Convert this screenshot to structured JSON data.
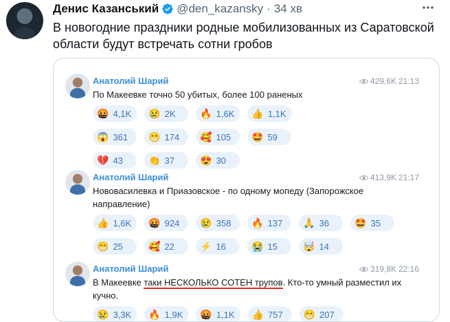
{
  "tweet": {
    "author": "Денис Казанський",
    "handle": "@den_kazansky",
    "dot": "·",
    "time": "34 хв",
    "text": "В новогодние праздники родные мобилизованных из Саратовской области будут встречать сотни гробов"
  },
  "quote": {
    "posts": [
      {
        "author": "Анатолий Шарий",
        "views": "429,6K",
        "time": "21:13",
        "text": "По Макеевке точно 50 убитых, более 100 раненых",
        "reaction_rows": [
          [
            {
              "emoji": "🤬",
              "count": "4,1K"
            },
            {
              "emoji": "😢",
              "count": "2K"
            },
            {
              "emoji": "🔥",
              "count": "1,6K"
            },
            {
              "emoji": "👍",
              "count": "1,1K"
            }
          ],
          [
            {
              "emoji": "😱",
              "count": "361"
            },
            {
              "emoji": "😁",
              "count": "174"
            },
            {
              "emoji": "🥰",
              "count": "105"
            },
            {
              "emoji": "🤩",
              "count": "59"
            }
          ],
          [
            {
              "emoji": "💔",
              "count": "43"
            },
            {
              "emoji": "👏",
              "count": "37"
            },
            {
              "emoji": "😍",
              "count": "30"
            }
          ]
        ]
      },
      {
        "author": "Анатолий Шарий",
        "views": "413,9K",
        "time": "21:17",
        "text": "Нововасилевка и Приазовское - по одному мопеду (Запорожское направление)",
        "reaction_rows": [
          [
            {
              "emoji": "👍",
              "count": "1,6K"
            },
            {
              "emoji": "🤬",
              "count": "924"
            },
            {
              "emoji": "😢",
              "count": "358"
            },
            {
              "emoji": "🔥",
              "count": "137"
            },
            {
              "emoji": "🙏",
              "count": "36"
            },
            {
              "emoji": "🤩",
              "count": "35"
            }
          ],
          [
            {
              "emoji": "😁",
              "count": "25"
            },
            {
              "emoji": "🥰",
              "count": "22"
            },
            {
              "emoji": "⚡",
              "count": "16"
            },
            {
              "emoji": "😭",
              "count": "15"
            },
            {
              "emoji": "🤯",
              "count": "14"
            }
          ]
        ]
      },
      {
        "author": "Анатолий Шарий",
        "views": "319,8K",
        "time": "22:16",
        "text_before": "В Макеевке ",
        "text_underlined": "таки НЕСКОЛЬКО СОТЕН трупов",
        "text_after": ". Кто-то умный разместил их кучно.",
        "reaction_rows": [
          [
            {
              "emoji": "😢",
              "count": "3,3K"
            },
            {
              "emoji": "🔥",
              "count": "1,9K"
            },
            {
              "emoji": "🤬",
              "count": "1,1K"
            },
            {
              "emoji": "👍",
              "count": "757"
            },
            {
              "emoji": "😁",
              "count": "207"
            }
          ]
        ]
      }
    ]
  },
  "colors": {
    "verified": "#1d9bf0",
    "tg_author": "#3b8fd6",
    "chip_bg": "#e9f2fb",
    "underline": "#e52727"
  },
  "icons": [
    "verified-badge-icon",
    "more-options-icon",
    "eye-icon"
  ]
}
